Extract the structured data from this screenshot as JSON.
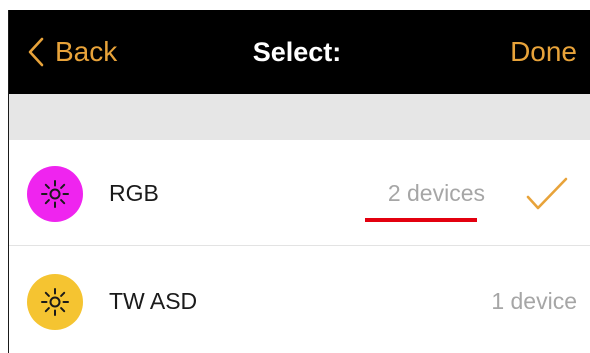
{
  "header": {
    "back_label": "Back",
    "title": "Select:",
    "done_label": "Done"
  },
  "groups": [
    {
      "label": "RGB",
      "count": "2 devices",
      "color": "#ef24ef",
      "selected": true,
      "icon": "sun-icon"
    },
    {
      "label": "TW ASD",
      "count": "1 device",
      "color": "#f5c431",
      "selected": false,
      "icon": "sun-icon"
    }
  ],
  "colors": {
    "accent": "#e8a33a",
    "header_bg": "#000000",
    "section_bg": "#e6e6e6",
    "annotation": "#e3000f"
  }
}
